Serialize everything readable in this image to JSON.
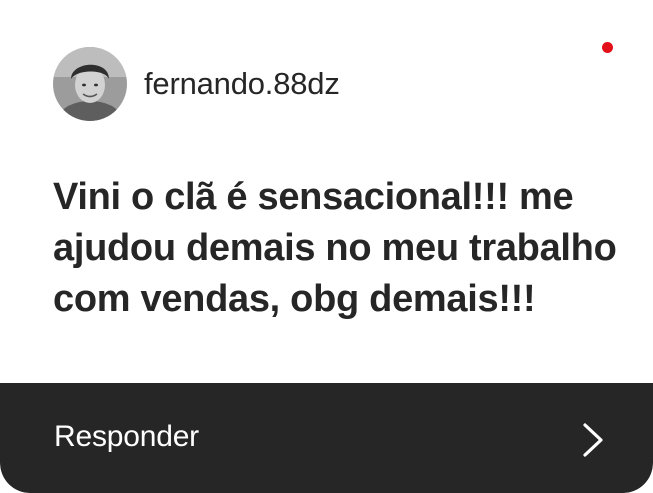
{
  "header": {
    "username": "fernando.88dz",
    "avatar_icon": "profile-photo",
    "notification_dot_color": "#e3101a"
  },
  "message": {
    "text": "Vini o clã é sensacional!!! me ajudou demais no meu trabalho com vendas, obg demais!!!"
  },
  "footer": {
    "reply_label": "Responder",
    "chevron_icon": "chevron-right-icon",
    "background_color": "#262626"
  }
}
